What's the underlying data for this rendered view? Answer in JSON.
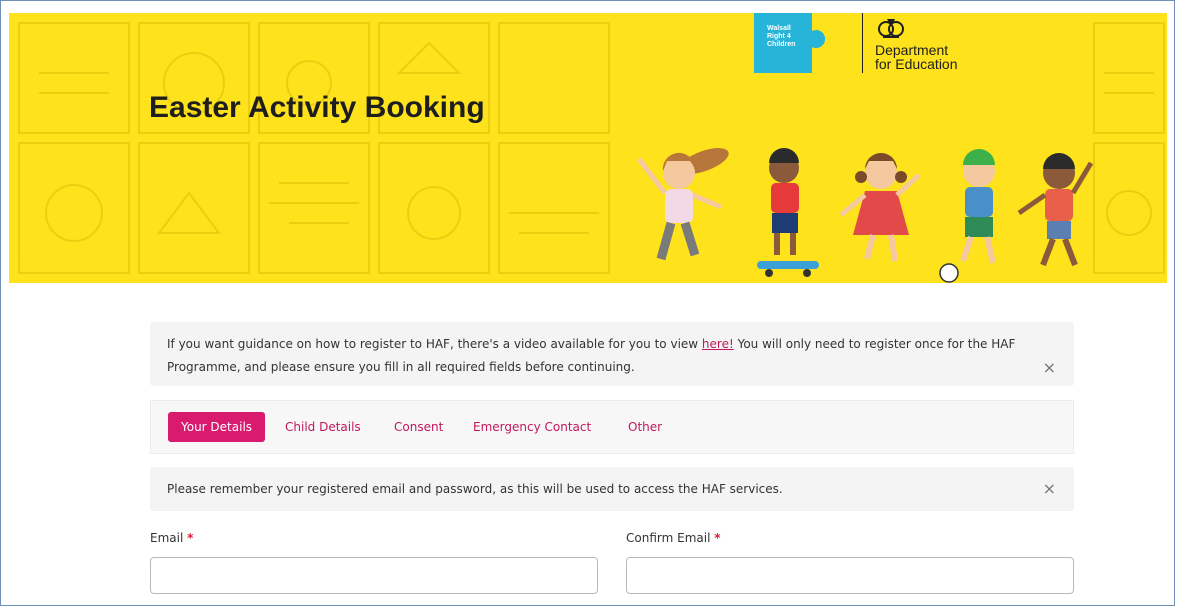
{
  "header": {
    "title": "Easter Activity Booking",
    "partner_logo_text": "Walsall Right 4 Children",
    "dfe_line1": "Department",
    "dfe_line2": "for Education",
    "accent_color": "#fde21c"
  },
  "guidance": {
    "text_before": "If you want guidance on how to register to HAF, there's a video available for you to view ",
    "link": "here!",
    "text_after": " You will only need to register once for the HAF Programme, and please ensure you fill in all required fields before continuing.",
    "close": "×"
  },
  "tabs": [
    {
      "label": "Your Details",
      "active": true
    },
    {
      "label": "Child Details",
      "active": false
    },
    {
      "label": "Consent",
      "active": false
    },
    {
      "label": "Emergency Contact",
      "active": false
    },
    {
      "label": "Other",
      "active": false
    }
  ],
  "reminder": {
    "text": "Please remember your registered email and password, as this will be used to access the HAF services.",
    "close": "×"
  },
  "form": {
    "email_label": "Email",
    "confirm_email_label": "Confirm Email",
    "required_mark": "*",
    "email_value": "",
    "confirm_email_value": ""
  },
  "colors": {
    "tab_active": "#d81b6e",
    "link": "#c2185b"
  }
}
